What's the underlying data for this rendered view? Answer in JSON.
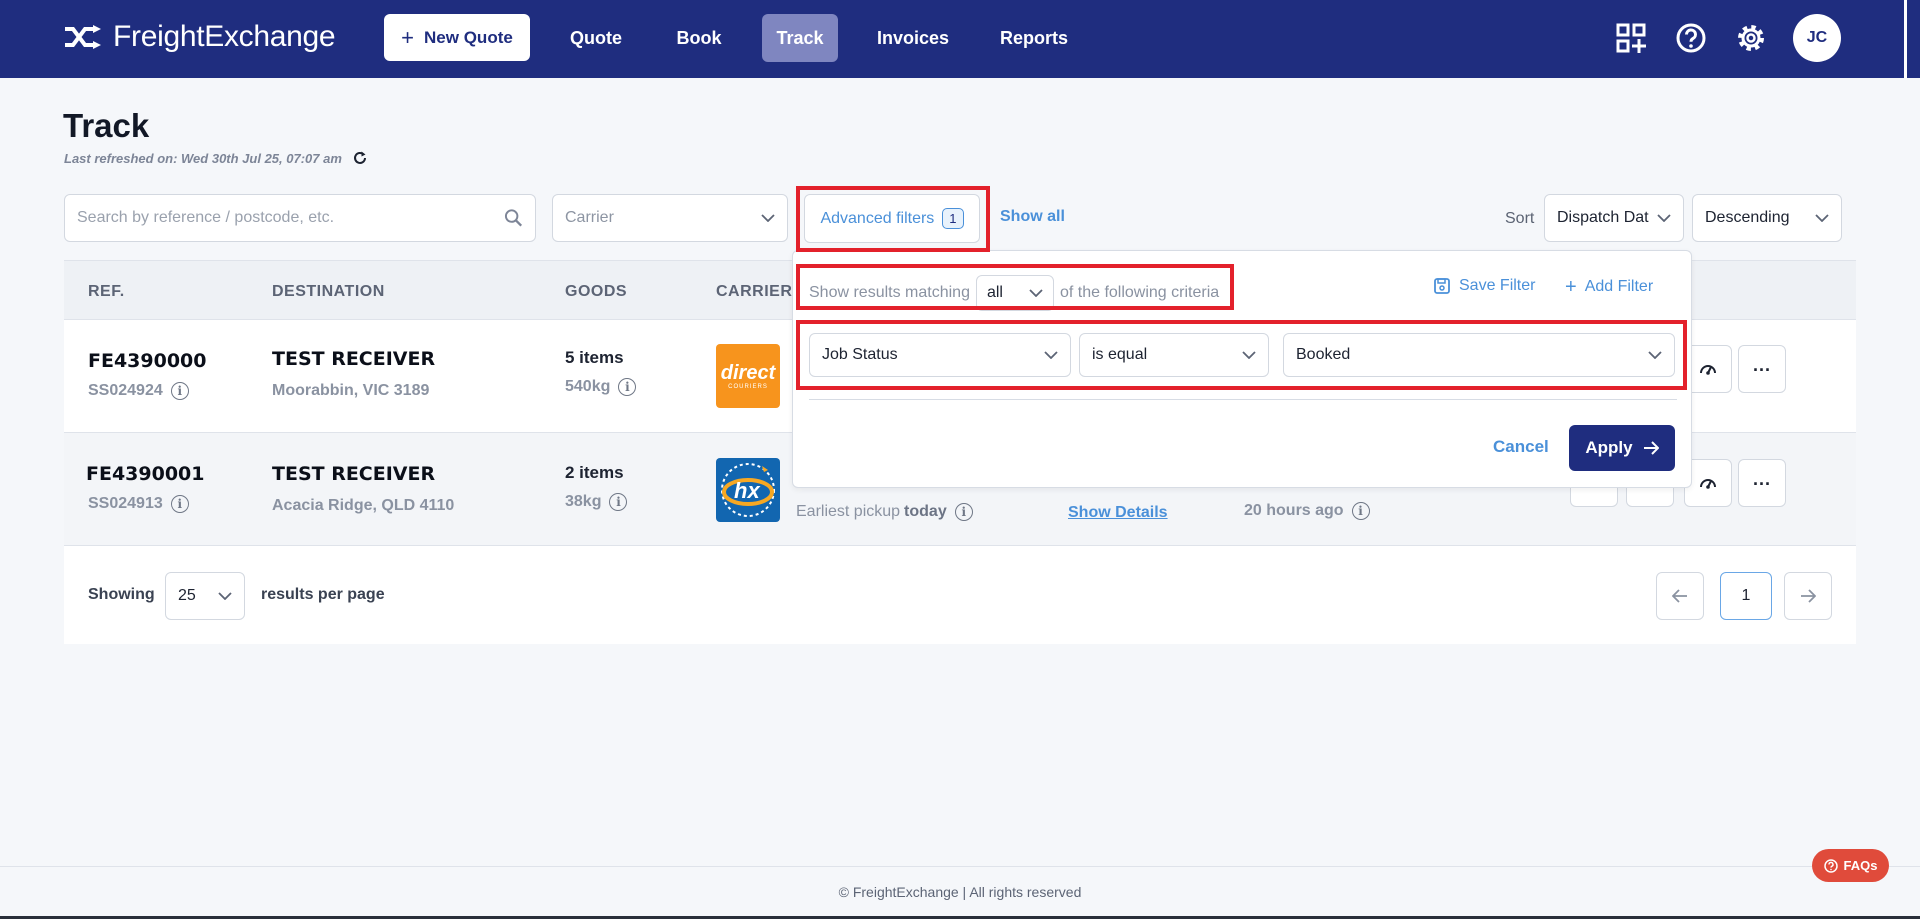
{
  "brand": {
    "name": "FreightExchange"
  },
  "nav": {
    "new_quote": "New Quote",
    "links": [
      "Quote",
      "Book",
      "Track",
      "Invoices",
      "Reports"
    ],
    "active": "Track",
    "user_initials": "JC",
    "icons": [
      "grid-plus-icon",
      "help-icon",
      "gear-icon"
    ]
  },
  "page": {
    "title": "Track",
    "last_refreshed": "Last refreshed on: Wed 30th Jul 25, 07:07 am"
  },
  "filters": {
    "search_placeholder": "Search by reference / postcode, etc.",
    "carrier_placeholder": "Carrier",
    "advanced_label": "Advanced filters",
    "advanced_count": "1",
    "show_all": "Show all",
    "sort_label": "Sort",
    "sort_field": "Dispatch Dat",
    "sort_order": "Descending"
  },
  "table": {
    "headers": [
      "REF.",
      "DESTINATION",
      "GOODS",
      "CARRIER"
    ],
    "rows": [
      {
        "ref": "FE4390000",
        "sub_ref": "SS024924",
        "dest_name": "TEST RECEIVER",
        "dest_addr": "Moorabbin, VIC 3189",
        "items": "5 items",
        "weight": "540kg",
        "carrier_logo": "direct-couriers-logo",
        "logo_word": "direct",
        "logo_sub": "COURIERS"
      },
      {
        "ref": "FE4390001",
        "sub_ref": "SS024913",
        "dest_name": "TEST RECEIVER",
        "dest_addr": "Acacia Ridge, QLD 4110",
        "items": "2 items",
        "weight": "38kg",
        "carrier_logo": "hx-logo",
        "logo_word": "hx",
        "pickup_prefix": "Earliest pickup",
        "pickup_when": "today",
        "details_link": "Show Details",
        "updated": "20 hours ago"
      }
    ]
  },
  "pagination": {
    "showing": "Showing",
    "per_page": "25",
    "per_page_suffix": "results per page",
    "current_page": "1"
  },
  "advanced_panel": {
    "match_prefix": "Show results matching",
    "match_mode": "all",
    "match_suffix": "of the following criteria",
    "save_filter": "Save Filter",
    "add_filter": "Add Filter",
    "field": "Job Status",
    "operator": "is equal",
    "value": "Booked",
    "cancel": "Cancel",
    "apply": "Apply"
  },
  "footer": {
    "copyright": "© FreightExchange | All rights reserved",
    "faq": "FAQs"
  },
  "colors": {
    "nav_bg": "#1f2d7f",
    "accent_link": "#4a90d9",
    "highlight": "#e3212b",
    "faq_bg": "#e04b3b"
  }
}
